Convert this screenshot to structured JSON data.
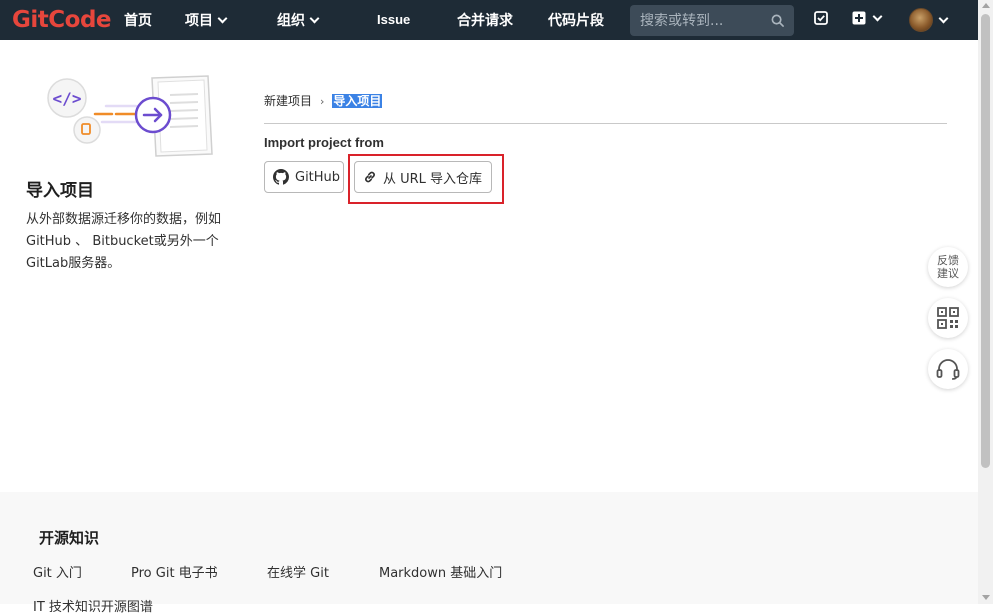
{
  "brand": {
    "logo_text": "GitCode",
    "logo_color": "#e6463c"
  },
  "nav": {
    "items": [
      {
        "label": "首页",
        "has_caret": false
      },
      {
        "label": "项目",
        "has_caret": true
      },
      {
        "label": "组织",
        "has_caret": true
      },
      {
        "label": "Issue",
        "has_caret": false
      },
      {
        "label": "合并请求",
        "has_caret": false
      },
      {
        "label": "代码片段",
        "has_caret": false
      }
    ],
    "search_placeholder": "搜索或转到...",
    "icons": [
      "todo-icon",
      "plus-square-icon",
      "avatar"
    ]
  },
  "sidebar": {
    "title": "导入项目",
    "description": "从外部数据源迁移你的数据，例如GitHub 、 Bitbucket或另外一个GitLab服务器。"
  },
  "breadcrumb": {
    "parent": "新建项目",
    "current": "导入项目"
  },
  "import": {
    "label": "Import project from",
    "sources": [
      {
        "label": "GitHub",
        "icon": "github-icon"
      },
      {
        "label": "从 URL 导入仓库",
        "icon": "link-icon"
      }
    ]
  },
  "float_actions": {
    "feedback_line1": "反馈",
    "feedback_line2": "建议",
    "icons": [
      "qrcode-icon",
      "headset-icon"
    ]
  },
  "footer": {
    "title": "开源知识",
    "links": [
      "Git 入门",
      "Pro Git 电子书",
      "在线学 Git",
      "Markdown 基础入门"
    ],
    "cut_text": "IT 技术知识开源图谱"
  },
  "colors": {
    "topbar": "#1e2b36",
    "accent_purple": "#6c4ccf",
    "highlight_red": "#d9222a",
    "selection_blue": "#3b82e5"
  }
}
